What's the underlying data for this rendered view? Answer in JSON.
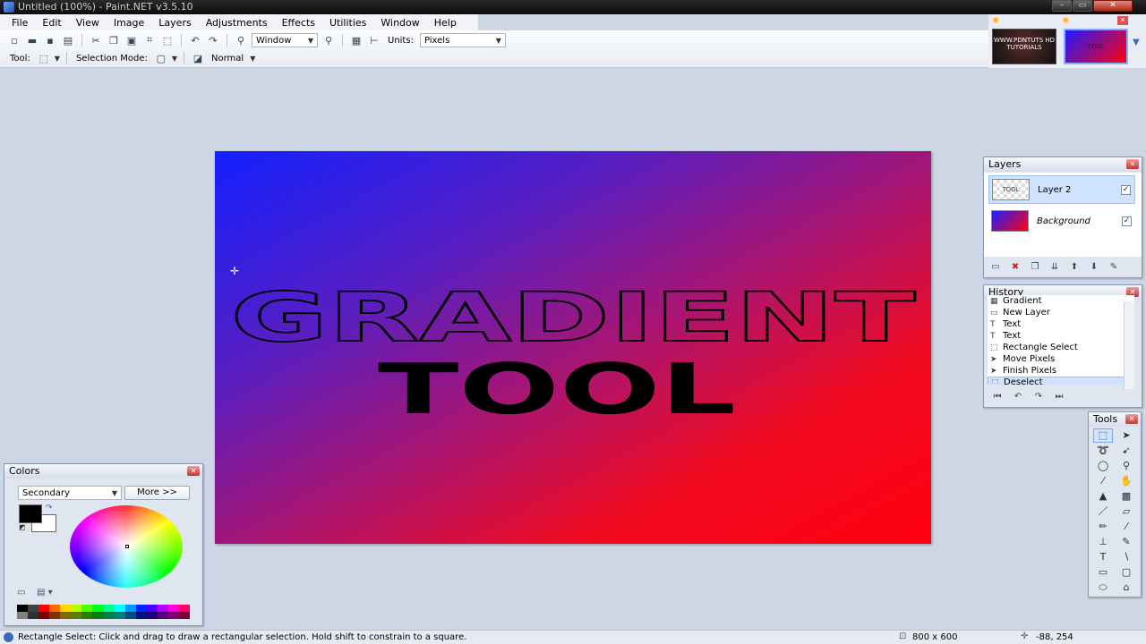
{
  "window": {
    "title": "Untitled (100%) - Paint.NET v3.5.10",
    "min": "–",
    "max": "▭",
    "close": "✕"
  },
  "menu": [
    "File",
    "Edit",
    "View",
    "Image",
    "Layers",
    "Adjustments",
    "Effects",
    "Utilities",
    "Window",
    "Help"
  ],
  "toolbar": {
    "zoom_value": "Window",
    "units_label": "Units:",
    "units_value": "Pixels",
    "tool_label": "Tool:",
    "selection_mode_label": "Selection Mode:",
    "blend_mode": "Normal"
  },
  "thumbnails": {
    "first_label": "WWW.PDNTUTS HD TUTORIALS",
    "second_label": "TOOL"
  },
  "canvas": {
    "line1": "GRADIENT",
    "line2": "TOOL",
    "gradient_colors": [
      "#1320ff",
      "#ff0010"
    ]
  },
  "layers": {
    "title": "Layers",
    "items": [
      {
        "name": "Layer 2",
        "visible": true,
        "thumb_label": "TOOL"
      },
      {
        "name": "Background",
        "visible": true
      }
    ]
  },
  "history": {
    "title": "History",
    "items": [
      "Gradient",
      "New Layer",
      "Text",
      "Text",
      "Rectangle Select",
      "Move Pixels",
      "Finish Pixels",
      "Deselect"
    ],
    "current": "Deselect"
  },
  "tools": {
    "title": "Tools"
  },
  "colors": {
    "title": "Colors",
    "mode": "Secondary",
    "more_button": "More >>",
    "primary": "#000000",
    "secondary": "#ffffff",
    "palette": [
      "#000000",
      "#404040",
      "#ff0000",
      "#ff6a00",
      "#ffd800",
      "#b6ff00",
      "#4cff00",
      "#00ff21",
      "#00ff90",
      "#00ffff",
      "#0094ff",
      "#0026ff",
      "#4800ff",
      "#b200ff",
      "#ff00dc",
      "#ff006e",
      "#808080",
      "#303030",
      "#7f0000",
      "#7f3300",
      "#7f6a00",
      "#5b7f00",
      "#267f00",
      "#007f0e",
      "#007f46",
      "#007f7f",
      "#004a7f",
      "#00137f",
      "#21007f",
      "#57007f",
      "#7f006e",
      "#7f0037"
    ]
  },
  "status": {
    "hint": "Rectangle Select: Click and drag to draw a rectangular selection. Hold shift to constrain to a square.",
    "image_size": "800 x 600",
    "cursor_pos": "-88, 254"
  }
}
